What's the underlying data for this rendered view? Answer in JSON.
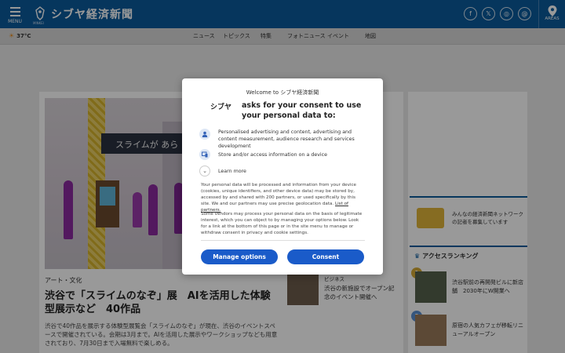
{
  "header": {
    "menu_label": "MENU",
    "logo_text": "シブヤ経済新聞",
    "logo_sub": "MINKEI",
    "areas_label": "AREAS",
    "social": [
      {
        "name": "facebook",
        "glyph": "f"
      },
      {
        "name": "x",
        "glyph": "𝕏"
      },
      {
        "name": "instagram",
        "glyph": "◎"
      },
      {
        "name": "threads",
        "glyph": "@"
      }
    ]
  },
  "navbar": {
    "weather": "37°C",
    "items": [
      "ニュース",
      "トピックス",
      "特集",
      "フォトニュース",
      "イベント",
      "地図"
    ]
  },
  "background": {
    "hero_sign": "スライムが あら",
    "category": "アート・文化",
    "headline": "渋谷で「スライムのなぞ」展　AIを活用した体験型展示など　40作品",
    "lead": "渋谷で40作品を展示する体験型展覧会「スライムのなぞ」が現在、渋谷のイベントスペースで開催されている。会期は3月まで。AIを活用した展示やワークショップなども用意されており、7月30日まで入場無料で楽しめる。",
    "small_category": "ビジネス",
    "small_title": "渋谷の新施設でオープン記念のイベント開催へ",
    "side_ad_text": "みんなの経済新聞ネットワークの記者を募集しています",
    "ranking_title": "アクセスランキング",
    "ranking": [
      {
        "rank": "1",
        "title": "渋谷駅前の再開発ビルに新店舗　2030年にW開業へ"
      },
      {
        "rank": "2",
        "title": "原宿の人気カフェが移転リニューアルオープン"
      }
    ]
  },
  "consent": {
    "welcome": "Welcome to シブヤ経済新聞",
    "site_logo": "シブヤ",
    "heading": "asks for your consent to use your personal data to:",
    "purposes": [
      {
        "icon": "person-icon",
        "glyph": "👤",
        "text": "Personalised advertising and content, advertising and content measurement, audience research and services development"
      },
      {
        "icon": "device-icon",
        "glyph": "▣",
        "text": "Store and/or access information on a device"
      }
    ],
    "learn_more": "Learn more",
    "paragraph1": "Your personal data will be processed and information from your device (cookies, unique identifiers, and other device data) may be stored by, accessed by and shared with 200 partners, or used specifically by this site. We and our partners may use precise geolocation data.",
    "partners_link": "List of partners.",
    "paragraph2": "Some vendors may process your personal data on the basis of legitimate interest, which you can object to by managing your options below. Look for a link at the bottom of this page or in the site menu to manage or withdraw consent in privacy and cookie settings.",
    "manage_label": "Manage options",
    "consent_label": "Consent"
  },
  "colors": {
    "header_bg": "#0b5a9c",
    "button_bg": "#1a5bc9"
  }
}
